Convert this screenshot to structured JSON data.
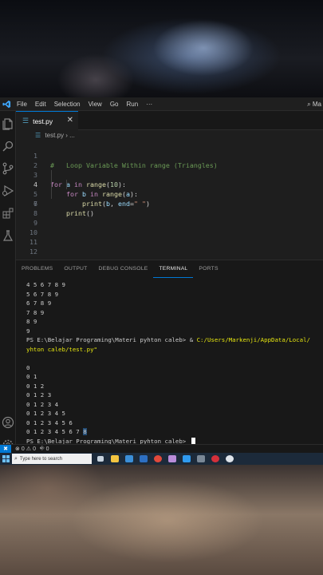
{
  "menubar": {
    "logo": "vscode-logo",
    "items": [
      "File",
      "Edit",
      "Selection",
      "View",
      "Go",
      "Run",
      "···"
    ],
    "search_partial": "Ma"
  },
  "tab": {
    "icon": "python-file-icon",
    "label": "test.py",
    "close_glyph": "✕"
  },
  "breadcrumb": {
    "file": "test.py",
    "sep": "›",
    "more": "..."
  },
  "editor": {
    "active_line": 4,
    "lines": [
      {
        "n": "1",
        "html": ""
      },
      {
        "n": "2",
        "html": ""
      },
      {
        "n": "3",
        "html": ""
      },
      {
        "n": "4",
        "html": ""
      },
      {
        "n": "5",
        "html": ""
      },
      {
        "n": "6",
        "html": ""
      },
      {
        "n": "7",
        "html": ""
      },
      {
        "n": "8",
        "html": ""
      },
      {
        "n": "9",
        "html": ""
      },
      {
        "n": "10",
        "html": ""
      },
      {
        "n": "11",
        "html": ""
      },
      {
        "n": "12",
        "html": ""
      }
    ],
    "code": {
      "l1_comment": "#   Loop Variable Within range (Triangles)",
      "l3_for": "for",
      "l3_a": "a",
      "l3_in": "in",
      "l3_range": "range",
      "l3_num": "10",
      "l4_for": "for",
      "l4_b": "b",
      "l4_in": "in",
      "l4_range": "range",
      "l4_arg": "a",
      "l5_print": "print",
      "l5_b": "b",
      "l5_end": "end",
      "l5_str": "\" \"",
      "l6_print": "print"
    }
  },
  "panel": {
    "tabs": [
      "PROBLEMS",
      "OUTPUT",
      "DEBUG CONSOLE",
      "TERMINAL",
      "PORTS"
    ],
    "active_tab": "TERMINAL"
  },
  "terminal": {
    "top_lines": [
      "4 5 6 7 8 9",
      "5 6 7 8 9",
      "6 7 8 9",
      "7 8 9",
      "8 9",
      "9"
    ],
    "prompt1": "PS E:\\Belajar Programing\\Materi pyhton caleb> ",
    "cmd_amp": "& ",
    "cmd_path": "C:/Users/Markenji/AppData/Local/",
    "cmd_cont": "yhton caleb/test.py\"",
    "output_lines": [
      "0",
      "0 1",
      "0 1 2",
      "0 1 2 3",
      "0 1 2 3 4",
      "0 1 2 3 4 5",
      "0 1 2 3 4 5 6",
      "0 1 2 3 4 5 6 7"
    ],
    "last_line_prefix": "0 1 2 3 4 5 6 7 ",
    "last_line_selected": "8",
    "prompt2": "PS E:\\Belajar Programing\\Materi pyhton caleb> "
  },
  "statusbar": {
    "remote_glyph": "✖",
    "errors": "0",
    "warnings": "0",
    "ports": "0"
  },
  "taskbar": {
    "search_placeholder": "Type here to search"
  }
}
